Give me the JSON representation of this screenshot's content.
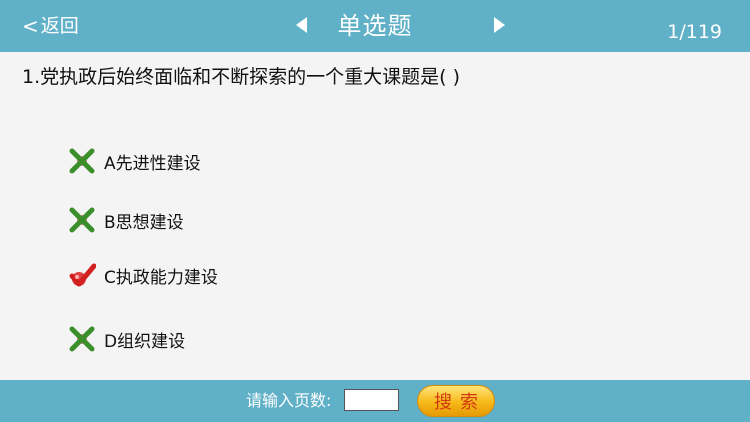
{
  "header": {
    "back_label": "返回",
    "back_chevron": "<",
    "title": "单选题",
    "counter": "1/119",
    "prev_icon": "triangle-left",
    "next_icon": "triangle-right"
  },
  "question": {
    "text": "1.党执政后始终面临和不断探索的一个重大课题是(     )"
  },
  "options": [
    {
      "label": "A先进性建设",
      "state": "wrong",
      "icon": "x-mark-icon"
    },
    {
      "label": "B思想建设",
      "state": "wrong",
      "icon": "x-mark-icon"
    },
    {
      "label": "C执政能力建设",
      "state": "correct",
      "icon": "check-mark-icon"
    },
    {
      "label": "D组织建设",
      "state": "wrong",
      "icon": "x-mark-icon"
    }
  ],
  "footer": {
    "page_label": "请输入页数:",
    "page_value": "",
    "search_label": "搜索"
  },
  "colors": {
    "bar": "#60b0c8",
    "wrong_mark": "#3a8f2a",
    "correct_mark": "#d21f1f",
    "search_button": "#f7b818"
  }
}
